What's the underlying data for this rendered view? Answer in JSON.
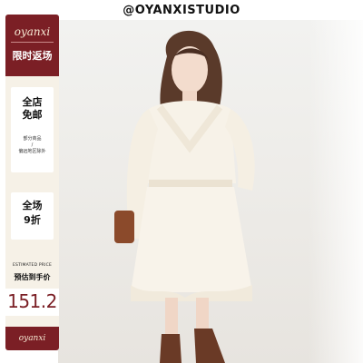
{
  "header": {
    "handle": "@OYANXISTUDIO"
  },
  "sidebar": {
    "brand_logo": "oyanxi",
    "limited_offer": "限时返场",
    "shipping_title_1": "全店",
    "shipping_title_2": "免邮",
    "shipping_note_1": "部分商品",
    "shipping_note_2": "/",
    "shipping_note_3": "偏远地区除外",
    "discount_title_1": "全场",
    "discount_title_2": "9折",
    "estimated_label": "ESTIMATED PRICE",
    "estimated_cn": "预估到手价",
    "price": "151.2",
    "brand_footer": "oyanxi"
  },
  "colors": {
    "brand_red": "#7b1f25",
    "cream": "#f6f1e7"
  }
}
